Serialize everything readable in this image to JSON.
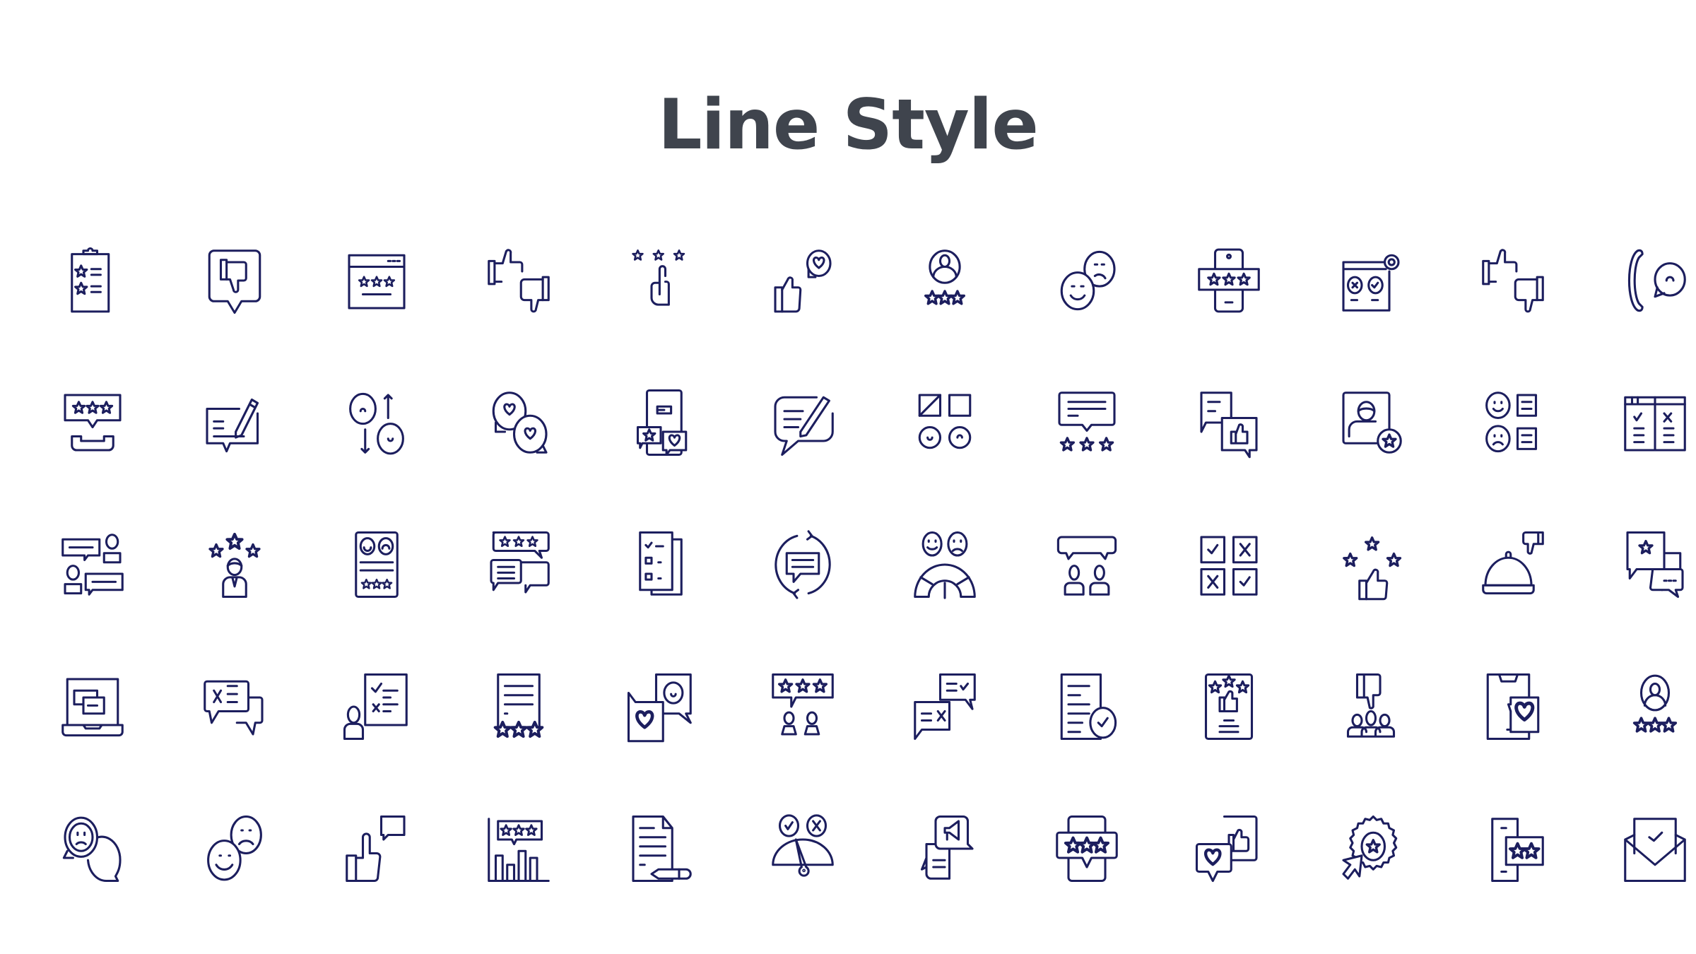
{
  "title": "Line Style",
  "colors": {
    "title": "#3f444d",
    "icon_stroke": "#1c1e5e",
    "background": "#ffffff"
  },
  "icons": [
    {
      "name": "clipboard-rating-icon"
    },
    {
      "name": "thumbs-down-bubble-icon"
    },
    {
      "name": "browser-rating-icon"
    },
    {
      "name": "thumbs-up-down-icon"
    },
    {
      "name": "finger-rating-icon"
    },
    {
      "name": "like-love-icon"
    },
    {
      "name": "user-rating-icon"
    },
    {
      "name": "happy-sad-faces-icon"
    },
    {
      "name": "mobile-rating-icon"
    },
    {
      "name": "browser-settings-check-icon"
    },
    {
      "name": "thumbs-up-down-alt-icon"
    },
    {
      "name": "phone-chat-icon"
    },
    {
      "name": "phone-rating-bubble-icon"
    },
    {
      "name": "write-review-icon"
    },
    {
      "name": "mood-up-down-icon"
    },
    {
      "name": "love-chat-icon"
    },
    {
      "name": "mobile-reviews-icon"
    },
    {
      "name": "chat-pencil-icon"
    },
    {
      "name": "mood-board-icon"
    },
    {
      "name": "message-stars-icon"
    },
    {
      "name": "chat-like-icon"
    },
    {
      "name": "profile-star-icon"
    },
    {
      "name": "mood-list-icon"
    },
    {
      "name": "pros-cons-table-icon"
    },
    {
      "name": "conversation-users-icon"
    },
    {
      "name": "businessman-stars-icon"
    },
    {
      "name": "feedback-form-icon"
    },
    {
      "name": "rating-chat-icon"
    },
    {
      "name": "checklist-icon"
    },
    {
      "name": "chat-refresh-icon"
    },
    {
      "name": "satisfaction-meter-icon"
    },
    {
      "name": "discussion-icon"
    },
    {
      "name": "check-cross-grid-icon"
    },
    {
      "name": "like-stars-icon"
    },
    {
      "name": "service-bell-dislike-icon"
    },
    {
      "name": "star-chat-icon"
    },
    {
      "name": "laptop-windows-icon"
    },
    {
      "name": "cross-chat-icon"
    },
    {
      "name": "presentation-checklist-icon"
    },
    {
      "name": "document-stars-icon"
    },
    {
      "name": "love-happy-cards-icon"
    },
    {
      "name": "group-rating-icon"
    },
    {
      "name": "check-cross-messages-icon"
    },
    {
      "name": "document-approved-icon"
    },
    {
      "name": "tablet-rating-like-icon"
    },
    {
      "name": "team-dislike-icon"
    },
    {
      "name": "mobile-love-icon"
    },
    {
      "name": "user-rating-alt-icon"
    },
    {
      "name": "sad-chat-icon"
    },
    {
      "name": "happy-sad-faces-alt-icon"
    },
    {
      "name": "like-comment-icon"
    },
    {
      "name": "rating-chart-icon"
    },
    {
      "name": "document-pencil-icon"
    },
    {
      "name": "approval-gauge-icon"
    },
    {
      "name": "announcement-chat-icon"
    },
    {
      "name": "mobile-rating-bubble-icon"
    },
    {
      "name": "like-love-chat-icon"
    },
    {
      "name": "badge-click-icon"
    },
    {
      "name": "mobile-two-stars-icon"
    },
    {
      "name": "envelope-check-icon"
    }
  ]
}
